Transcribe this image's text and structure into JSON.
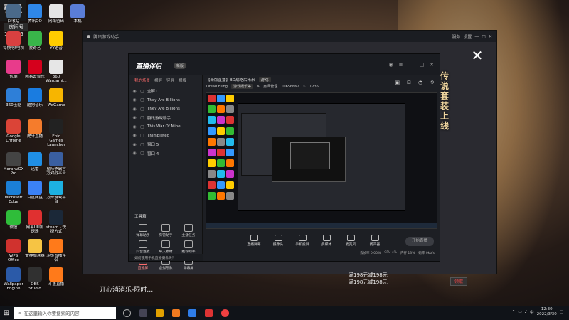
{
  "watermark": {
    "brand": "引量",
    "room_label": "房间号",
    "room_no": "100656"
  },
  "desktop_icons": [
    {
      "id": "recycle",
      "label": "回收站",
      "color": "#4a6a8a"
    },
    {
      "id": "qq-browser",
      "label": "腾讯QQ",
      "color": "#2f87e8"
    },
    {
      "id": "notes",
      "label": "网络密码",
      "color": "#e5e5e5"
    },
    {
      "id": "pc",
      "label": "本机",
      "color": "#5a7dd6"
    },
    {
      "id": "assistant",
      "label": "每快吧!电视",
      "color": "#d94040"
    },
    {
      "id": "aiqiyi",
      "label": "爱奇艺",
      "color": "#39b54a"
    },
    {
      "id": "yy",
      "label": "YY语音",
      "color": "#ffcc00"
    },
    {
      "id": "youku",
      "label": "优酷",
      "color": "#e83b8b"
    },
    {
      "id": "netease",
      "label": "网易云音乐",
      "color": "#d5001c"
    },
    {
      "id": "360game",
      "label": "360 Wargami...",
      "color": "#e6e6e6"
    },
    {
      "id": "360safe",
      "label": "360压缩",
      "color": "#2e7fd8"
    },
    {
      "id": "kugou",
      "label": "酷狗音乐",
      "color": "#1a7ce0"
    },
    {
      "id": "wegame",
      "label": "WeGame",
      "color": "#f7b500"
    },
    {
      "id": "chrome",
      "label": "Google Chrome",
      "color": "#db4437"
    },
    {
      "id": "huya",
      "label": "虎牙直播",
      "color": "#f57c2c"
    },
    {
      "id": "epic",
      "label": "Epic Games Launcher",
      "color": "#222"
    },
    {
      "id": "morph",
      "label": "MorphVOX Pro",
      "color": "#444"
    },
    {
      "id": "xunlei",
      "label": "迅雷",
      "color": "#1f8fe6"
    },
    {
      "id": "pubg",
      "label": "星际争霸官方对战平台",
      "color": "#3a5fa0"
    },
    {
      "id": "edge",
      "label": "Microsoft Edge",
      "color": "#1b7fd6"
    },
    {
      "id": "baidu-net",
      "label": "百度网盘",
      "color": "#3b82f6"
    },
    {
      "id": "steam-cn",
      "label": "方舟游戏平台",
      "color": "#1db1e2"
    },
    {
      "id": "wechat",
      "label": "微信",
      "color": "#2fbd3a"
    },
    {
      "id": "neteaseuu",
      "label": "网易UU加速器",
      "color": "#e03030"
    },
    {
      "id": "steam",
      "label": "steam - 快捷方式",
      "color": "#1b2838"
    },
    {
      "id": "wps",
      "label": "WPS Office",
      "color": "#d0322e"
    },
    {
      "id": "qq-music",
      "label": "雷神加速器",
      "color": "#f6c444"
    },
    {
      "id": "douyu",
      "label": "斗鱼直播伴侣",
      "color": "#ff7a1a"
    },
    {
      "id": "wallpaper",
      "label": "Wallpaper Engine",
      "color": "#2b5aa8"
    },
    {
      "id": "obs",
      "label": "OBS Studio",
      "color": "#303030"
    },
    {
      "id": "douyu2",
      "label": "斗鱼直播",
      "color": "#ff7a1a"
    }
  ],
  "outer_window": {
    "title": "腾讯游戏助手",
    "controls": [
      "服务",
      "设置",
      "—",
      "□",
      "✕"
    ]
  },
  "studio": {
    "logo": "直播伴侣",
    "version": "新版",
    "scene_tabs": [
      "我的场景",
      "横屏",
      "竖屏",
      "横版"
    ],
    "sources": [
      "全屏1",
      "They Are Billions",
      "They Are Billions",
      "腾讯游戏助手",
      "This War Of Mine",
      "Thimbleted",
      "窗口 5",
      "窗口 4"
    ],
    "tools_title": "工具箱",
    "tools": [
      {
        "label": "弹幕助手",
        "hot": false
      },
      {
        "label": "房管助手",
        "hot": false
      },
      {
        "label": "主播任务",
        "hot": false
      },
      {
        "label": "抖音连麦",
        "hot": false
      },
      {
        "label": "导入素材",
        "hot": false
      },
      {
        "label": "推荐助手",
        "hot": false
      },
      {
        "label": "直播屏",
        "hot": true
      },
      {
        "label": "虚拟形象",
        "hot": false
      },
      {
        "label": "弹幕屏",
        "hot": false
      }
    ],
    "footer": "如何使用手机直播摄像头？",
    "room_title": "【新版直播】BO战略后来来",
    "room_tag": "游戏",
    "room_line2_name": "Dread Hung",
    "room_line2_cat": "游戏娱乐等",
    "room_line2_mod": "房间管理",
    "room_line2_id": "10656662",
    "room_line2_fans": "1235",
    "bottom_tools": [
      "直播屏幕",
      "摄像头",
      "手机投屏",
      "多媒体",
      "麦克风",
      "扬声器"
    ],
    "start_label": "开始直播",
    "status": [
      "丢帧率 0.00%",
      "CPU 4%",
      "内存 13%",
      "码率 0kb/s"
    ]
  },
  "background_texts": {
    "left_strip": "开心消消乐-限时…",
    "price1": "满198元减198元",
    "price2": "满198元减198元",
    "button": "领取",
    "vertical": "传说套装上线"
  },
  "taskbar": {
    "start_icon": "windows-icon",
    "search_placeholder": "在这里输入你要搜索的内容",
    "time": "12:30",
    "date": "2022/3/30"
  }
}
